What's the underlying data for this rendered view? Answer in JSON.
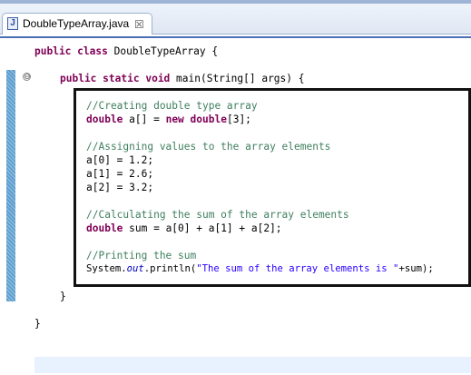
{
  "editor_tab": {
    "title": "DoubleTypeArray.java",
    "file_icon": "J",
    "close_icon": "☒"
  },
  "gutter": {
    "fold_icon": "⊖"
  },
  "code": {
    "class_decl": {
      "kw1": "public",
      "kw2": "class",
      "name": " DoubleTypeArray {"
    },
    "main_decl": {
      "kw1": "public",
      "kw2": "static",
      "kw3": "void",
      "rest": " main(String[] args) {"
    },
    "comment_create": "//Creating double type array",
    "array_decl": {
      "kw1": "double",
      "mid": " a[] = ",
      "kw2": "new",
      "kw3": "double",
      "end": "[3];"
    },
    "comment_assign": "//Assigning values to the array elements",
    "assign_0": "a[0] = 1.2;",
    "assign_1": "a[1] = 2.6;",
    "assign_2": "a[2] = 3.2;",
    "comment_calc": "//Calculating the sum of the array elements",
    "sum_decl": {
      "kw": "double",
      "rest": " sum = a[0] + a[1] + a[2];"
    },
    "comment_print": "//Printing the sum",
    "println": {
      "pre": "System.",
      "field": "out",
      "mid": ".println(",
      "str": "\"The sum of the array elements is \"",
      "end": "+sum);"
    },
    "close_main": "}",
    "close_class": "}"
  }
}
